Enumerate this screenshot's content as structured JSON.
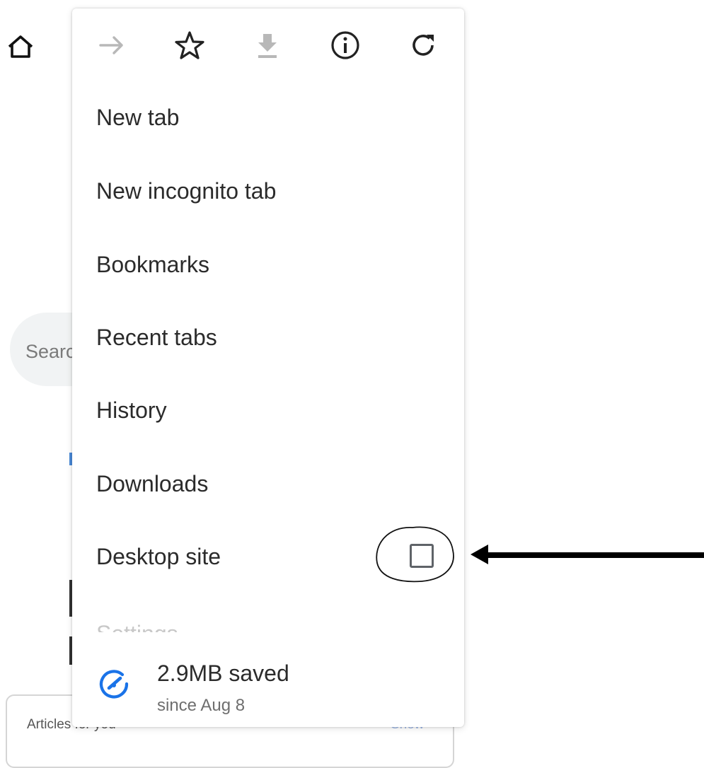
{
  "background": {
    "search_placeholder": "Searc",
    "articles_label": "Articles for you",
    "articles_action": "Show",
    "home_icon": "home-icon"
  },
  "menu": {
    "toolbar": [
      {
        "icon": "forward-arrow-icon",
        "enabled": false
      },
      {
        "icon": "star-bookmark-icon",
        "enabled": true
      },
      {
        "icon": "download-icon",
        "enabled": false
      },
      {
        "icon": "info-icon",
        "enabled": true
      },
      {
        "icon": "refresh-icon",
        "enabled": true
      }
    ],
    "items": [
      {
        "label": "New tab"
      },
      {
        "label": "New incognito tab"
      },
      {
        "label": "Bookmarks"
      },
      {
        "label": "Recent tabs"
      },
      {
        "label": "History"
      },
      {
        "label": "Downloads"
      },
      {
        "label": "Desktop site",
        "checked": false
      },
      {
        "label": "Settings"
      }
    ],
    "data_saver": {
      "amount": "2.9MB saved",
      "since": "since Aug 8",
      "icon": "data-saver-gauge-icon",
      "icon_color": "#1a73e8"
    }
  },
  "annotation": {
    "shapes": [
      "hand-drawn-circle",
      "left-pointing-arrow"
    ],
    "color": "#000000"
  }
}
